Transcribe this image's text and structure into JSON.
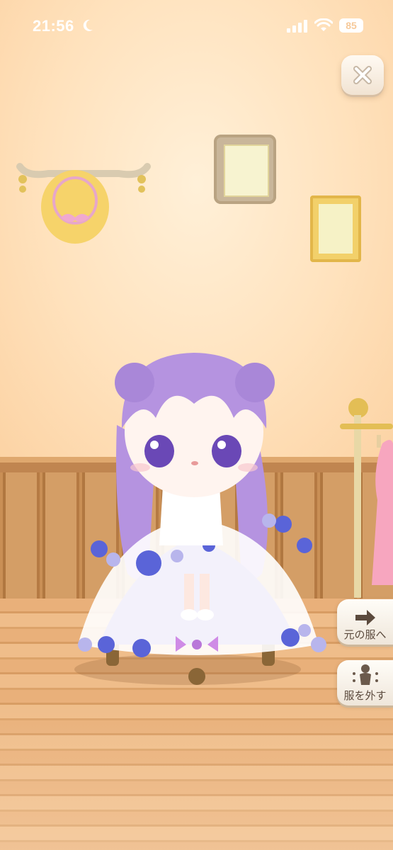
{
  "status_bar": {
    "time": "21:56",
    "battery_level": "85"
  },
  "buttons": {
    "revert_label": "元の服へ",
    "undress_label": "服を外す"
  },
  "icons": [
    "moon-icon",
    "signal-icon",
    "wifi-icon",
    "battery-icon",
    "close-icon",
    "arrow-right-icon",
    "undress-figure-icon"
  ],
  "colors": {
    "hair": "#b79be0",
    "roses": "#5a64d8",
    "dress": "#ffffff",
    "wall": "#ffe2bd",
    "wood": "#c98f55"
  }
}
